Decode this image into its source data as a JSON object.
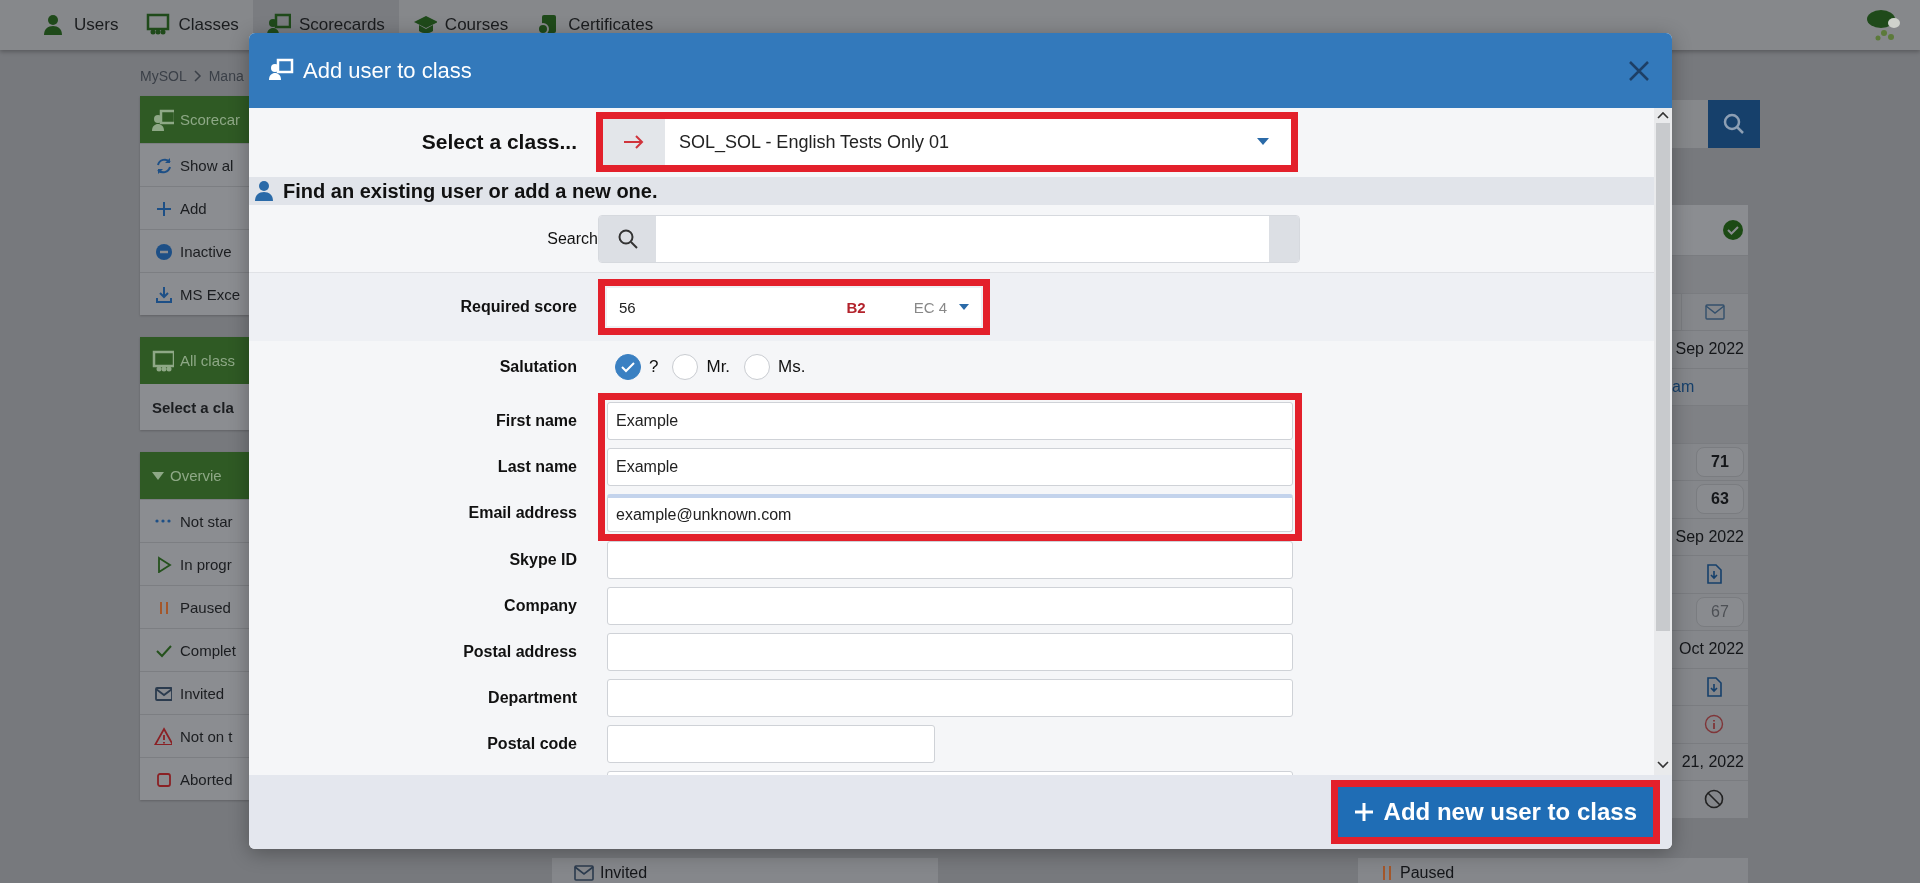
{
  "nav": {
    "items": [
      {
        "label": "Users",
        "selected": false
      },
      {
        "label": "Classes",
        "selected": false
      },
      {
        "label": "Scorecards",
        "selected": true
      },
      {
        "label": "Courses",
        "selected": false
      },
      {
        "label": "Certificates",
        "selected": false
      }
    ]
  },
  "breadcrumb": [
    "MySOL",
    "Mana"
  ],
  "sidebar": {
    "panels": [
      {
        "title": "Scorecar",
        "kind": "menu",
        "items": [
          "Show al",
          "Add",
          "Inactive",
          "MS Exce"
        ]
      },
      {
        "title": "All class",
        "kind": "select",
        "value": "Select a cla"
      },
      {
        "title": "Overvie",
        "kind": "menu",
        "items": [
          "Not star",
          "In progr",
          "Paused",
          "Complet",
          "Invited",
          "Not on t",
          "Aborted"
        ]
      }
    ]
  },
  "right_column": {
    "cells": [
      {
        "kind": "check"
      },
      {
        "kind": "band"
      },
      {
        "kind": "mail"
      },
      {
        "kind": "text",
        "text": "Sep 2022"
      },
      {
        "kind": "link",
        "text": "am"
      },
      {
        "kind": "band"
      },
      {
        "kind": "score",
        "text": "71"
      },
      {
        "kind": "score",
        "text": "63"
      },
      {
        "kind": "text",
        "text": "Sep 2022"
      },
      {
        "kind": "download"
      },
      {
        "kind": "faded",
        "text": "67"
      },
      {
        "kind": "text",
        "text": "Oct 2022"
      },
      {
        "kind": "download"
      },
      {
        "kind": "info"
      },
      {
        "kind": "text",
        "text": "21, 2022"
      },
      {
        "kind": "ban"
      }
    ]
  },
  "bottom_cards": [
    {
      "label": "Invited"
    },
    {
      "label": "Paused"
    }
  ],
  "dialog": {
    "title": "Add user to class",
    "class_select": {
      "label": "Select a class...",
      "value": "SOL_SOL - English Tests Only 01",
      "highlighted": true
    },
    "section": "Find an existing user or add a new one.",
    "search": {
      "label": "Search"
    },
    "required_score": {
      "label": "Required score",
      "value": "56",
      "grade": "B2",
      "ec": "EC 4",
      "highlighted": true
    },
    "salutation": {
      "label": "Salutation",
      "options": [
        {
          "label": "?",
          "selected": true
        },
        {
          "label": "Mr.",
          "selected": false
        },
        {
          "label": "Ms.",
          "selected": false
        }
      ]
    },
    "field_groups": [
      {
        "highlighted": true,
        "fields": [
          {
            "label": "First name",
            "value": "Example",
            "kind": "wide",
            "focused": false
          },
          {
            "label": "Last name",
            "value": "Example",
            "kind": "wide",
            "focused": false
          },
          {
            "label": "Email address",
            "value": "example@unknown.com",
            "kind": "wide",
            "focused": true
          }
        ]
      },
      {
        "highlighted": false,
        "fields": [
          {
            "label": "Skype ID",
            "kind": "wide",
            "focused": false
          },
          {
            "label": "Company",
            "kind": "wide",
            "focused": false
          },
          {
            "label": "Postal address",
            "kind": "wide",
            "focused": false
          },
          {
            "label": "Department",
            "kind": "wide",
            "focused": false
          },
          {
            "label": "Postal code",
            "kind": "narrow",
            "focused": false
          },
          {
            "kind": "wide",
            "focused": false
          }
        ]
      }
    ],
    "submit": {
      "label": "Add new user to class",
      "highlighted": true
    }
  }
}
